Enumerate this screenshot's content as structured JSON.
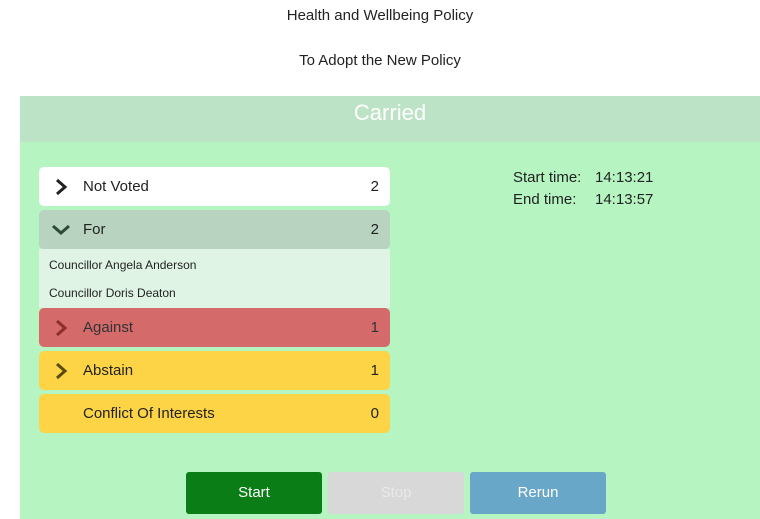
{
  "header": {
    "policy_title": "Health and Wellbeing Policy",
    "motion_title": "To Adopt the New Policy"
  },
  "result": {
    "label": "Carried"
  },
  "vote_groups": [
    {
      "label": "Not Voted",
      "count": "2",
      "icon": "chevron-right-icon",
      "color": "#ffffff"
    },
    {
      "label": "For",
      "count": "2",
      "icon": "chevron-down-icon",
      "color": "#b8d4c0",
      "members": [
        "Councillor Angela Anderson",
        "Councillor Doris Deaton"
      ]
    },
    {
      "label": "Against",
      "count": "1",
      "icon": "chevron-right-icon",
      "color": "#d46a6a"
    },
    {
      "label": "Abstain",
      "count": "1",
      "icon": "chevron-right-icon",
      "color": "#fcd445"
    },
    {
      "label": "Conflict Of Interests",
      "count": "0",
      "icon": "",
      "color": "#fcd445"
    }
  ],
  "times": {
    "start_label": "Start time:",
    "start_value": "14:13:21",
    "end_label": "End time:",
    "end_value": "14:13:57"
  },
  "buttons": {
    "start": "Start",
    "stop": "Stop",
    "rerun": "Rerun"
  },
  "colors": {
    "result_bar": "#bde3c6",
    "panel": "#b6f5c2",
    "start": "#0b7d16",
    "stop_disabled": "#d8d8d8",
    "rerun": "#68a7c8"
  }
}
